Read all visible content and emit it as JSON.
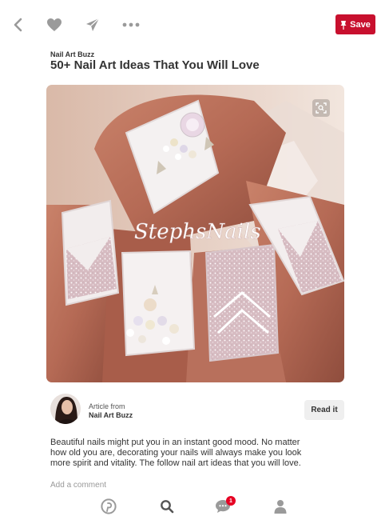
{
  "header": {
    "icons": [
      "back-icon",
      "heart-icon",
      "send-icon",
      "more-icon"
    ],
    "save_label": "Save",
    "save_color": "#c8102e"
  },
  "pin": {
    "source": "Nail Art Buzz",
    "title": "50+ Nail Art Ideas That You Will Love",
    "watermark": "StephsNails"
  },
  "attribution": {
    "article_from": "Article from",
    "author": "Nail Art Buzz",
    "read_label": "Read it"
  },
  "description": "Beautiful nails might put you in an instant good mood. No matter how old you are, decorating your nails will always make you look more spirit and vitality. The follow nail art ideas that you will love.",
  "comment_placeholder": "Add a comment",
  "nav": {
    "icons": [
      "pinterest-icon",
      "search-icon",
      "chat-icon",
      "profile-icon"
    ],
    "notification_count": "1"
  }
}
